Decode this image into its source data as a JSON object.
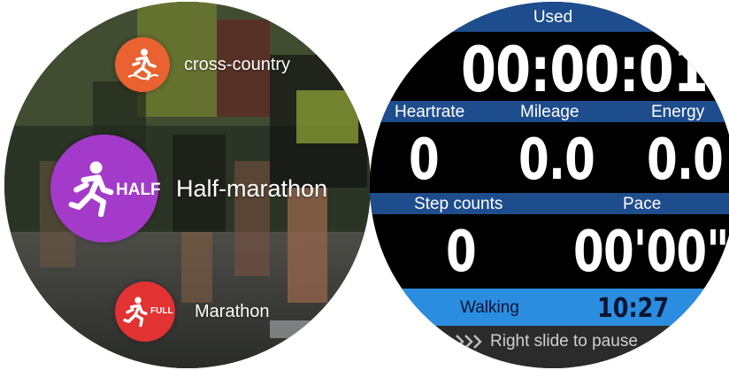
{
  "sport_menu": {
    "items": [
      {
        "label": "cross-country",
        "icon": "running-trail-icon",
        "color": "#e9622f"
      },
      {
        "label": "Half-marathon",
        "icon": "running-half-icon",
        "badge": "HALF",
        "color": "#a33ac9"
      },
      {
        "label": "Marathon",
        "icon": "running-full-icon",
        "badge": "FULL",
        "color": "#e23232"
      }
    ]
  },
  "workout": {
    "used_label": "Used",
    "elapsed": "00:00:01",
    "heartrate_label": "Heartrate",
    "heartrate": "0",
    "mileage_label": "Mileage",
    "mileage": "0.0",
    "energy_label": "Energy",
    "energy": "0.0",
    "step_label": "Step counts",
    "steps": "0",
    "pace_label": "Pace",
    "pace": "00'00\"",
    "mode": "Walking",
    "clock": "10:27",
    "hint": "Right slide to pause",
    "colors": {
      "band": "#1e4d8e",
      "highlight": "#2a8de0",
      "hint_bar": "#2b2b2b"
    }
  }
}
